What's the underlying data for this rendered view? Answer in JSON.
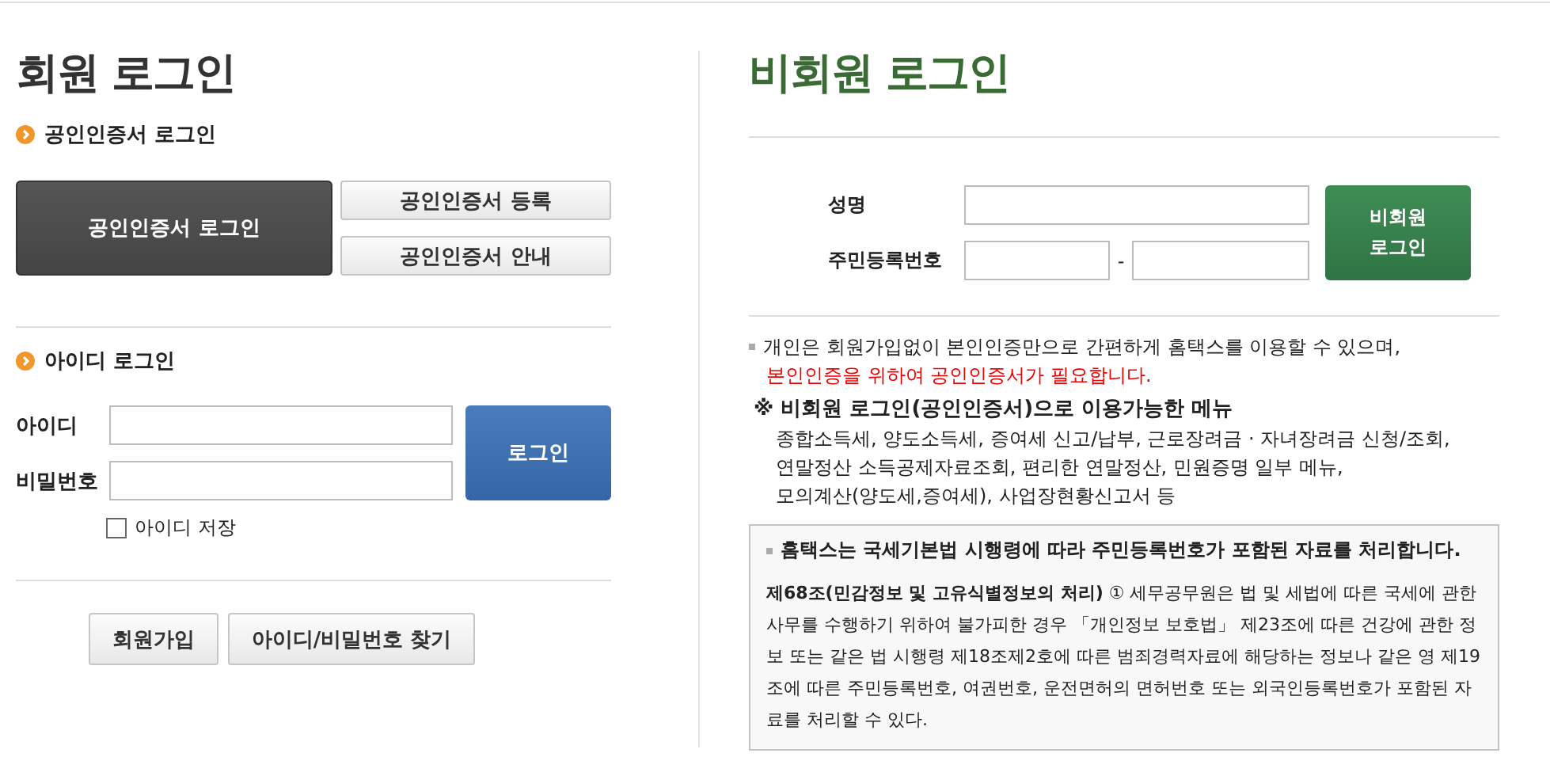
{
  "member_login": {
    "title": "회원 로그인",
    "cert_section": {
      "heading": "공인인증서 로그인",
      "main_button": "공인인증서 로그인",
      "side_buttons": [
        "공인인증서 등록",
        "공인인증서 안내"
      ]
    },
    "id_section": {
      "heading": "아이디 로그인",
      "fields": [
        {
          "label": "아이디"
        },
        {
          "label": "비밀번호"
        }
      ],
      "login_button": "로그인",
      "save_id": {
        "label": "아이디 저장",
        "checked": false
      }
    },
    "bottom_buttons": [
      "회원가입",
      "아이디/비밀번호 찾기"
    ]
  },
  "guest_login": {
    "title": "비회원 로그인",
    "name_label": "성명",
    "rrn_label": "주민등록번호",
    "rrn_separator": "-",
    "login_button": "비회원\n로그인",
    "notice": "개인은 회원가입없이 본인인증만으로 간편하게 홈택스를 이용할 수 있으며,",
    "notice_warning": "본인인증을 위하여 공인인증서가 필요합니다.",
    "menu_heading": "※ 비회원 로그인(공인인증서)으로 이용가능한 메뉴",
    "menu_lines": [
      "종합소득세, 양도소득세, 증여세 신고/납부, 근로장려금 · 자녀장려금 신청/조회,",
      "연말정산 소득공제자료조회, 편리한 연말정산, 민원증명 일부 메뉴,",
      "모의계산(양도세,증여세), 사업장현황신고서 등"
    ],
    "privacy_box": {
      "heading": "홈택스는 국세기본법 시행령에 따라 주민등록번호가 포함된 자료를 처리합니다.",
      "body": "**제68조(민감정보 및 고유식별정보의 처리)** ① 세무공무원은 법 및 세법에 따른 국세에 관한 사무를 수행하기 위하여 불가피한 경우 「개인정보 보호법」 제23조에 따른 건강에 관한 정보 또는 같은 법 시행령 제18조제2호에 따른 범죄경력자료에 해당하는 정보나 같은 영 제19조에 따른 주민등록번호, 여권번호, 운전면허의 면허번호 또는 외국인등록번호가 포함된 자료를 처리할 수 있다."
    }
  }
}
